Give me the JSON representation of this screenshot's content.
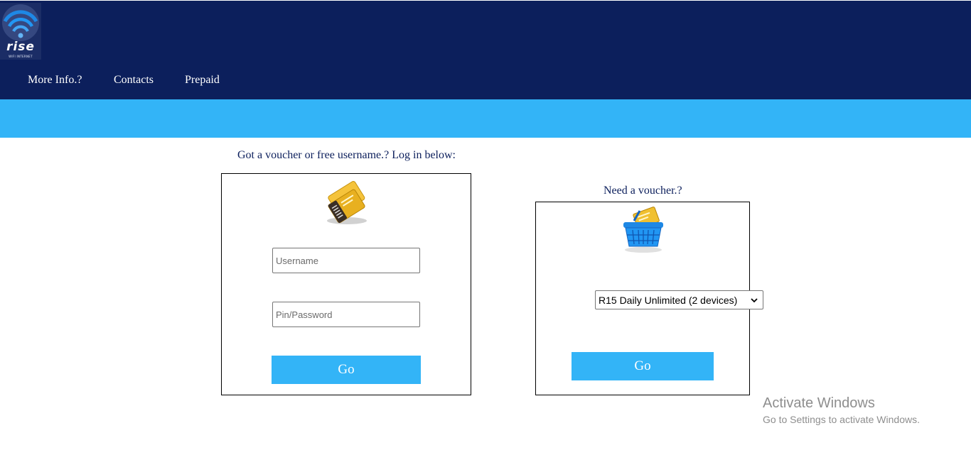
{
  "brand": {
    "logo_name": "rise",
    "logo_tagline": "WIFI INTERNET",
    "header_color": "#0c1f5c",
    "accent_color": "#33b4f7"
  },
  "nav": {
    "items": [
      {
        "label": "More Info.?"
      },
      {
        "label": "Contacts"
      },
      {
        "label": "Prepaid"
      }
    ]
  },
  "login": {
    "caption": "Got a voucher or free username.? Log in below:",
    "icon": "voucher-card-icon",
    "username_placeholder": "Username",
    "password_placeholder": "Pin/Password",
    "go_label": "Go"
  },
  "purchase": {
    "caption": "Need a voucher.?",
    "icon": "shopping-basket-icon",
    "selected_option": "R15 Daily Unlimited (2 devices)",
    "go_label": "Go"
  },
  "watermark": {
    "title": "Activate Windows",
    "subtitle": "Go to Settings to activate Windows."
  }
}
